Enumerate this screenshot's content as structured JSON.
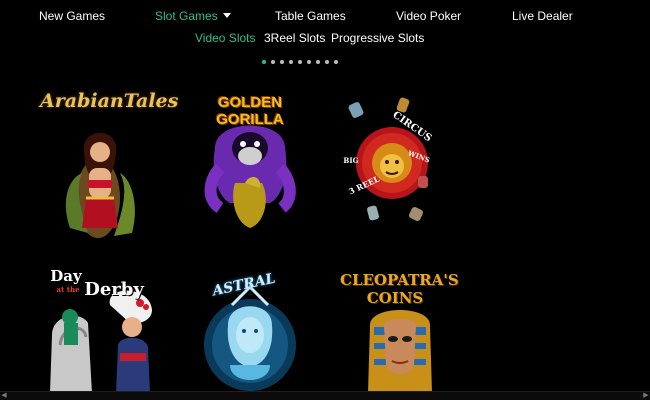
{
  "nav": {
    "items": [
      {
        "label": "New Games"
      },
      {
        "label": "Slot Games"
      },
      {
        "label": "Table Games"
      },
      {
        "label": "Video Poker"
      },
      {
        "label": "Live Dealer"
      }
    ]
  },
  "subnav": {
    "items": [
      {
        "label": "Video Slots"
      },
      {
        "label": "3Reel Slots"
      },
      {
        "label": "Progressive Slots"
      }
    ]
  },
  "carousel": {
    "page_count": 9,
    "active_page": 1
  },
  "games": [
    {
      "title": "ArabianTales"
    },
    {
      "title": "GOLDEN GORILLA"
    },
    {
      "title_top": "BIG",
      "title_main": "CIRCUS",
      "title_bottom": "3 REEL",
      "title_wins": "WINS"
    },
    {
      "title_line1": "Day",
      "title_line2": "at the",
      "title_line3": "Derby"
    },
    {
      "title": "ASTRAL"
    },
    {
      "title_line1": "CLEOPATRA'S",
      "title_line2": "COINS"
    }
  ],
  "colors": {
    "accent": "#2fbf8f",
    "background": "#000000",
    "text": "#ffffff"
  }
}
